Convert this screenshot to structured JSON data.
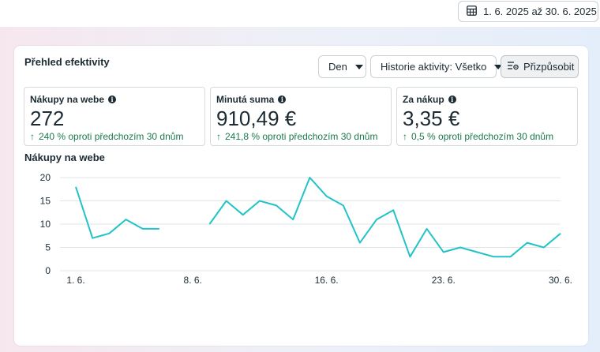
{
  "date_range": {
    "label": "1. 6. 2025 až 30. 6. 2025"
  },
  "card": {
    "title": "Přehled efektivity",
    "granularity": "Den",
    "activity_history": "Historie aktivity: Všetko",
    "customize": "Přizpůsobit"
  },
  "metrics": [
    {
      "label": "Nákupy na webe",
      "value": "272",
      "change": "240 % oproti předchozím 30 dnům"
    },
    {
      "label": "Minutá suma",
      "value": "910,49 €",
      "change": "241,8 % oproti předchozím 30 dnům"
    },
    {
      "label": "Za nákup",
      "value": "3,35 €",
      "change": "0,5 % oproti předchozím 30 dnům"
    }
  ],
  "colors": {
    "line": "#21c3c8",
    "positive": "#1a7a4d",
    "grid": "#e1e5e8"
  },
  "chart_data": {
    "type": "line",
    "title": "Nákupy na webe",
    "ylim": [
      0,
      20
    ],
    "y_ticks": [
      "0",
      "5",
      "10",
      "15",
      "20"
    ],
    "x_ticks": [
      {
        "day": 1,
        "label": "1. 6."
      },
      {
        "day": 8,
        "label": "8. 6."
      },
      {
        "day": 16,
        "label": "16. 6."
      },
      {
        "day": 23,
        "label": "23. 6."
      },
      {
        "day": 30,
        "label": "30. 6."
      }
    ],
    "grid": true,
    "series": [
      {
        "x": [
          1,
          2,
          3,
          4,
          5,
          6,
          7,
          8,
          9,
          10,
          11,
          12,
          13,
          14,
          15,
          16,
          17,
          18,
          19,
          20,
          21,
          22,
          23,
          24,
          25,
          26,
          27,
          28,
          29,
          30
        ],
        "values": [
          18,
          7,
          8,
          11,
          9,
          9,
          null,
          null,
          10,
          15,
          12,
          15,
          14,
          11,
          20,
          16,
          14,
          6,
          11,
          13,
          3,
          9,
          4,
          5,
          4,
          3,
          3,
          6,
          5,
          8
        ]
      }
    ]
  }
}
